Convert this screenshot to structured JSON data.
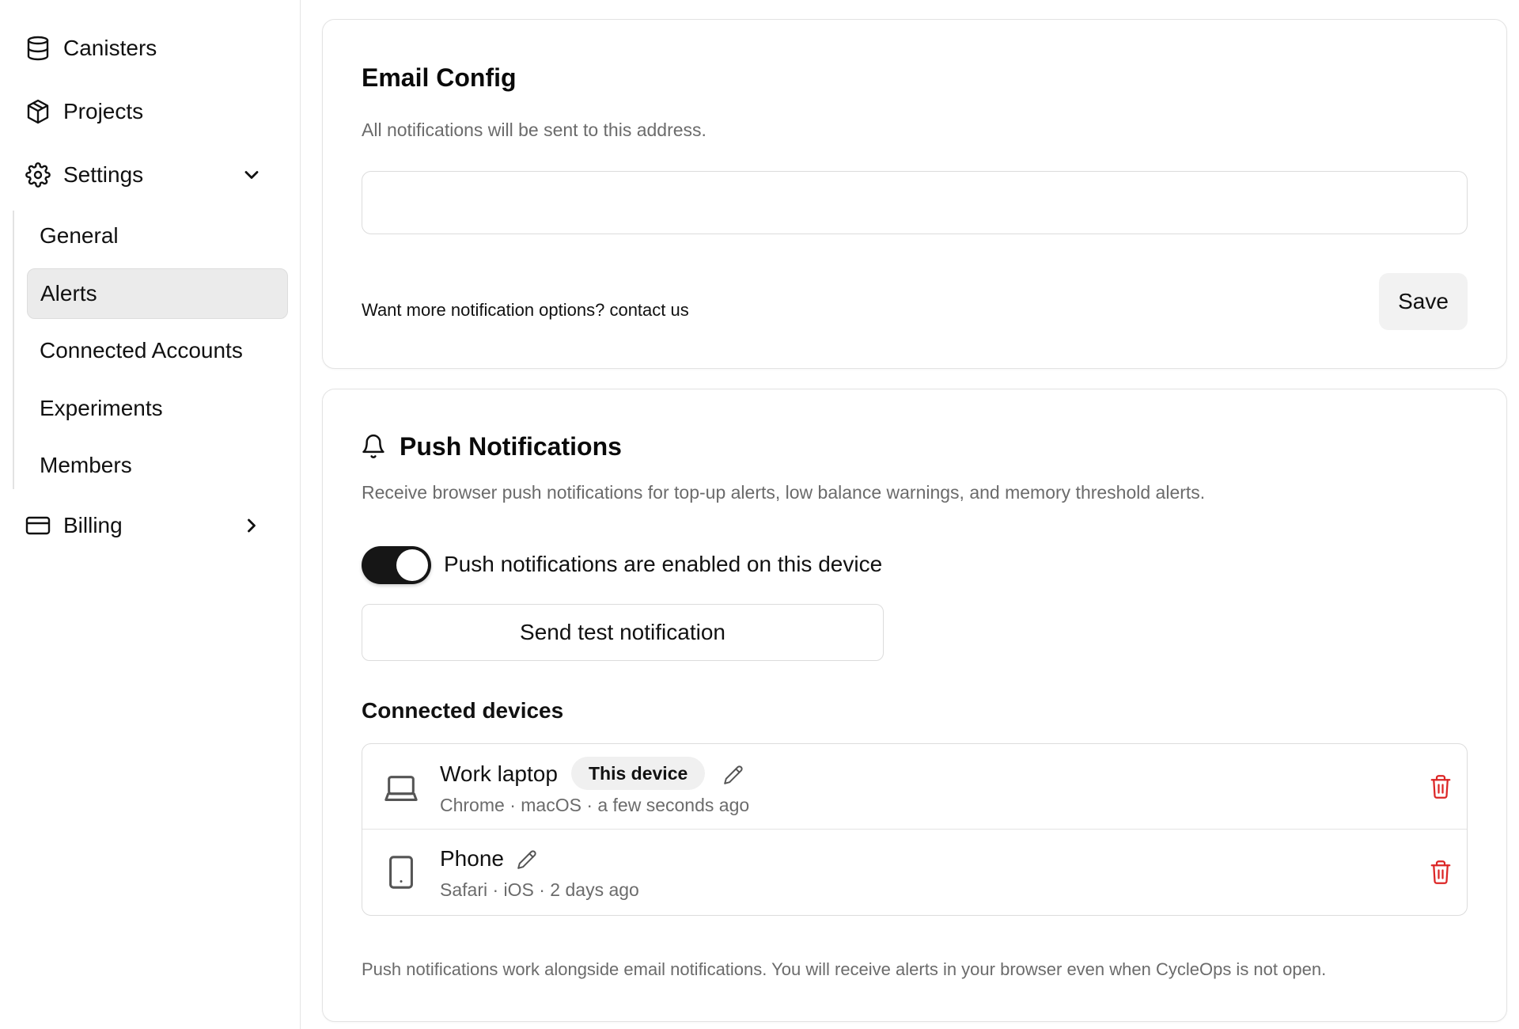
{
  "sidebar": {
    "items": [
      {
        "label": "Canisters",
        "icon": "database-icon"
      },
      {
        "label": "Projects",
        "icon": "cube-icon"
      },
      {
        "label": "Settings",
        "icon": "gear-icon",
        "expanded": true
      },
      {
        "label": "Billing",
        "icon": "credit-card-icon",
        "expanded": false
      }
    ],
    "settings_sub": [
      {
        "label": "General",
        "active": false
      },
      {
        "label": "Alerts",
        "active": true
      },
      {
        "label": "Connected Accounts",
        "active": false
      },
      {
        "label": "Experiments",
        "active": false
      },
      {
        "label": "Members",
        "active": false
      }
    ]
  },
  "email_config": {
    "title": "Email Config",
    "description": "All notifications will be sent to this address.",
    "input_value": "",
    "input_placeholder": "",
    "footer_text": "Want more notification options? contact us",
    "save_label": "Save"
  },
  "push": {
    "title": "Push Notifications",
    "description": "Receive browser push notifications for top-up alerts, low balance warnings, and memory threshold alerts.",
    "toggle_enabled": true,
    "toggle_label": "Push notifications are enabled on this device",
    "test_button_label": "Send test notification",
    "devices_heading": "Connected devices",
    "devices": [
      {
        "name": "Work laptop",
        "badge": "This device",
        "meta": "Chrome · macOS · a few seconds ago",
        "icon": "laptop-icon"
      },
      {
        "name": "Phone",
        "badge": "",
        "meta": "Safari · iOS · 2 days ago",
        "icon": "tablet-icon"
      }
    ],
    "footer_text": "Push notifications work alongside email notifications. You will receive alerts in your browser even when CycleOps is not open."
  },
  "colors": {
    "accent_dark": "#161616",
    "danger": "#dc2626",
    "muted_text": "#6b6b6b",
    "border": "#e3e3e3"
  }
}
